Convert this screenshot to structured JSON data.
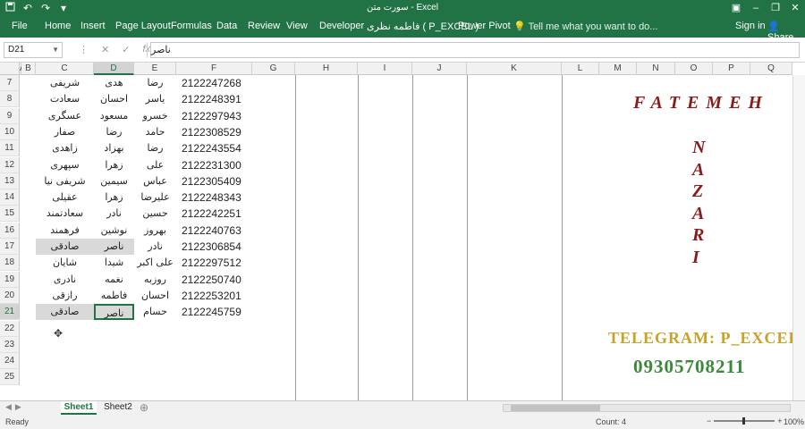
{
  "titlebar": {
    "title": "سورت متن - Excel",
    "qat_icons": [
      "save-icon",
      "undo-icon",
      "redo-icon",
      "customize-icon"
    ],
    "controls": [
      "ribbon-display-icon",
      "minimize-icon",
      "restore-icon",
      "close-icon"
    ]
  },
  "ribbon": {
    "tabs": [
      "File",
      "Home",
      "Insert",
      "Page Layout",
      "Formulas",
      "Data",
      "Review",
      "Developer",
      "فاطمه نظری ( P_EXCEL )",
      "Power Pivot"
    ],
    "tell_me": "Tell me what you want to do...",
    "sign_in": "Sign in",
    "share": "Share"
  },
  "formula_bar": {
    "name_box": "D21",
    "cancel": "✕",
    "enter": "✓",
    "fx": "fx",
    "value": "ناصر"
  },
  "columns": [
    "A",
    "B",
    "C",
    "D",
    "E",
    "F",
    "G",
    "H",
    "I",
    "J",
    "K",
    "L",
    "M",
    "N",
    "O",
    "P",
    "Q"
  ],
  "selected_column": "D",
  "rows": [
    {
      "n": "7",
      "c": "شریفی",
      "d": "هدی",
      "e": "رضا",
      "f": "2122247268"
    },
    {
      "n": "8",
      "c": "سعادت",
      "d": "احسان",
      "e": "یاسر",
      "f": "2122248391"
    },
    {
      "n": "9",
      "c": "عسگری",
      "d": "مسعود",
      "e": "خسرو",
      "f": "2122297943"
    },
    {
      "n": "10",
      "c": "صفار",
      "d": "رضا",
      "e": "حامد",
      "f": "2122308529"
    },
    {
      "n": "11",
      "c": "زاهدی",
      "d": "بهزاد",
      "e": "رضا",
      "f": "2122243554"
    },
    {
      "n": "12",
      "c": "سپهری",
      "d": "زهرا",
      "e": "علی",
      "f": "2122231300"
    },
    {
      "n": "13",
      "c": "شریفی نیا",
      "d": "سیمین",
      "e": "عباس",
      "f": "2122305409"
    },
    {
      "n": "14",
      "c": "عقیلی",
      "d": "زهرا",
      "e": "علیرضا",
      "f": "2122248343"
    },
    {
      "n": "15",
      "c": "سعادتمند",
      "d": "نادر",
      "e": "حسین",
      "f": "2122242251"
    },
    {
      "n": "16",
      "c": "فرهمند",
      "d": "نوشین",
      "e": "بهروز",
      "f": "2122240763"
    },
    {
      "n": "17",
      "c": "صادقی",
      "d": "ناصر",
      "e": "نادر",
      "f": "2122306854"
    },
    {
      "n": "18",
      "c": "شایان",
      "d": "شیدا",
      "e": "علی اکبر",
      "f": "2122297512"
    },
    {
      "n": "19",
      "c": "نادری",
      "d": "نغمه",
      "e": "روزبه",
      "f": "2122250740"
    },
    {
      "n": "20",
      "c": "رازقی",
      "d": "فاطمه",
      "e": "احسان",
      "f": "2122253201"
    },
    {
      "n": "21",
      "c": "صادقی",
      "d": "ناصر",
      "e": "حسام",
      "f": "2122245759"
    },
    {
      "n": "22",
      "c": "",
      "d": "",
      "e": "",
      "f": ""
    },
    {
      "n": "23",
      "c": "",
      "d": "",
      "e": "",
      "f": ""
    },
    {
      "n": "24",
      "c": "",
      "d": "",
      "e": "",
      "f": ""
    },
    {
      "n": "25",
      "c": "",
      "d": "",
      "e": "",
      "f": ""
    }
  ],
  "watermark": {
    "first": "FATEMEH",
    "last_letters": [
      "N",
      "A",
      "Z",
      "A",
      "R",
      "I"
    ],
    "telegram": "TELEGRAM: P_EXCEL",
    "phone": "09305708211"
  },
  "sheets": [
    "Sheet1",
    "Sheet2"
  ],
  "status": {
    "ready": "Ready",
    "count": "Count: 4",
    "zoom": "100%"
  }
}
